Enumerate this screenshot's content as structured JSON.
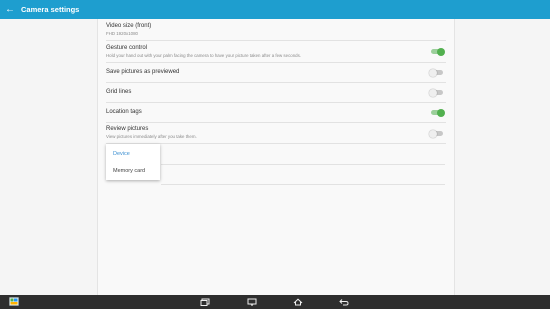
{
  "appbar": {
    "title": "Camera settings"
  },
  "settings": {
    "video_size_label": "Video size (front)",
    "video_size_value": "FHD 1920x1080",
    "gesture_label": "Gesture control",
    "gesture_sub": "Hold your hand out with your palm facing the camera to have your picture taken after a few seconds.",
    "save_label": "Save pictures as previewed",
    "grid_label": "Grid lines",
    "location_label": "Location tags",
    "review_label": "Review pictures",
    "review_sub": "View pictures immediately after you take them."
  },
  "switch_states": {
    "gesture": "on",
    "save": "off",
    "grid": "off",
    "location": "on",
    "review": "off"
  },
  "storage_popup": {
    "options": [
      "Device",
      "Memory card"
    ],
    "selected": "Device"
  },
  "colors": {
    "appbar": "#1e9ecf",
    "switch_on": "#52b04f",
    "selected_option": "#3b8fd1",
    "navbar": "#2e2e2e"
  }
}
